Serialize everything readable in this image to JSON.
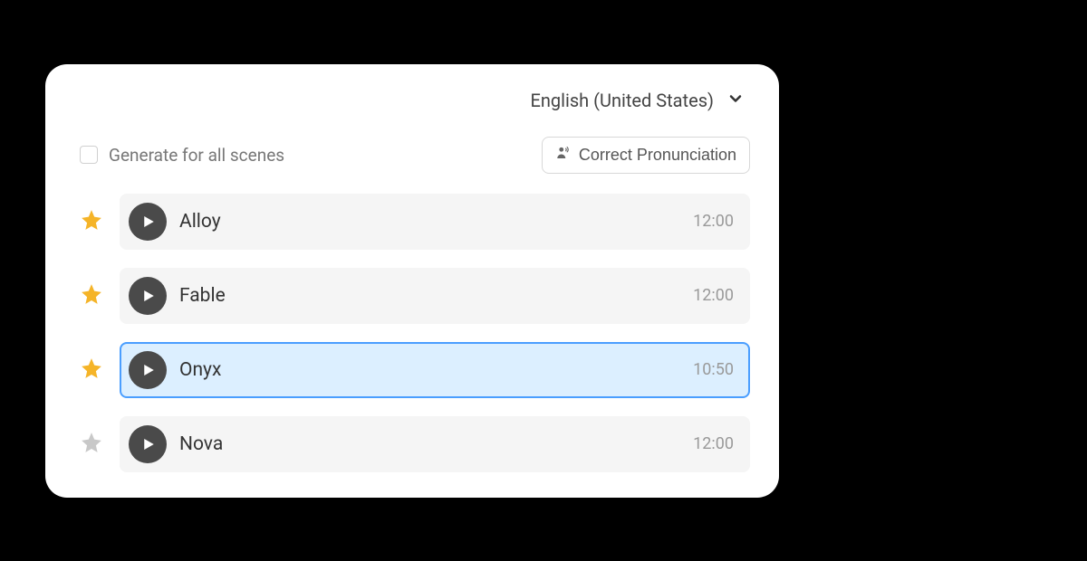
{
  "language": {
    "selected": "English (United States)"
  },
  "options": {
    "generate_all_label": "Generate for all scenes",
    "correct_pronunciation_label": "Correct Pronunciation"
  },
  "voices": [
    {
      "name": "Alloy",
      "time": "12:00",
      "starred": true,
      "selected": false
    },
    {
      "name": "Fable",
      "time": "12:00",
      "starred": true,
      "selected": false
    },
    {
      "name": "Onyx",
      "time": "10:50",
      "starred": true,
      "selected": true
    },
    {
      "name": "Nova",
      "time": "12:00",
      "starred": false,
      "selected": false
    }
  ],
  "colors": {
    "star_on": "#f5b428",
    "star_off": "#c8c8c8"
  }
}
